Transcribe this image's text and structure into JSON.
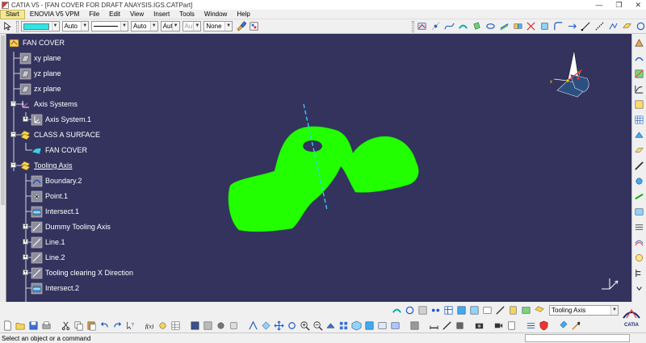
{
  "window": {
    "title": "CATIA V5 - [FAN COVER FOR DRAFT ANAYSIS.IGS.CATPart]",
    "minimize": "—",
    "restore": "❐",
    "close": "✕"
  },
  "menu": {
    "items": [
      {
        "label": "Start",
        "active": true
      },
      {
        "label": "ENOVIA V5 VPM"
      },
      {
        "label": "File"
      },
      {
        "label": "Edit"
      },
      {
        "label": "View"
      },
      {
        "label": "Insert"
      },
      {
        "label": "Tools"
      },
      {
        "label": "Window"
      },
      {
        "label": "Help"
      }
    ]
  },
  "graphic_properties": {
    "fill_color": "#2ee6e6",
    "transparency": "Auto",
    "linetype": "Auto",
    "line_thickness": "Aut",
    "point_symbol": "Aut",
    "layer": "None"
  },
  "tree": {
    "items": [
      {
        "label": "FAN COVER",
        "icon": "part-icon"
      },
      {
        "label": "xy plane",
        "icon": "plane-icon"
      },
      {
        "label": "yz plane",
        "icon": "plane-icon"
      },
      {
        "label": "zx plane",
        "icon": "plane-icon"
      },
      {
        "label": "Axis Systems",
        "icon": "axis-systems-icon"
      },
      {
        "label": "Axis System.1",
        "icon": "axis-system-icon"
      },
      {
        "label": "CLASS A SURFACE",
        "icon": "geometrical-set-icon"
      },
      {
        "label": "FAN COVER",
        "icon": "surface-icon"
      },
      {
        "label": "Tooling Axis",
        "icon": "geometrical-set-icon",
        "underlined": true
      },
      {
        "label": "Boundary.2",
        "icon": "boundary-icon"
      },
      {
        "label": "Point.1",
        "icon": "point-icon"
      },
      {
        "label": "Intersect.1",
        "icon": "intersect-icon"
      },
      {
        "label": "Dummy Tooling Axis",
        "icon": "line-icon"
      },
      {
        "label": "Line.1",
        "icon": "line-icon"
      },
      {
        "label": "Line.2",
        "icon": "line-icon"
      },
      {
        "label": "Tooling clearing X Direction",
        "icon": "line-icon"
      },
      {
        "label": "Intersect.2",
        "icon": "intersect-icon"
      }
    ]
  },
  "compass": {
    "x_label": "x",
    "y_label": "y"
  },
  "model": {
    "surface_color": "#22ff00",
    "axis_color": "#33d6ff"
  },
  "current_set": {
    "value": "Tooling Axis"
  },
  "brand": {
    "label": "CATIA"
  },
  "status": {
    "text": "Select an object or a command"
  }
}
